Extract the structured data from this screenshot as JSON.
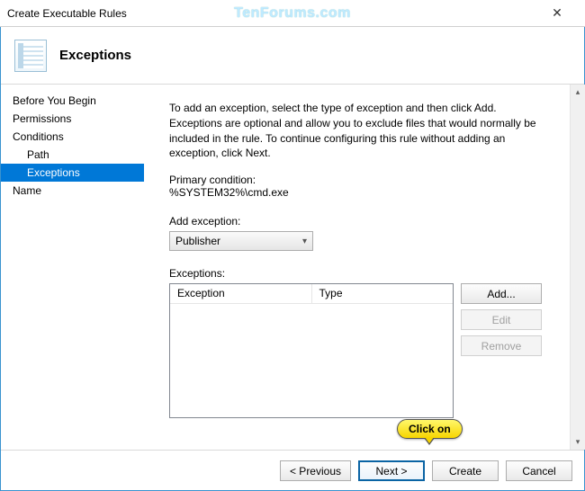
{
  "window": {
    "title": "Create Executable Rules",
    "watermark": "TenForums.com"
  },
  "header": {
    "title": "Exceptions"
  },
  "nav": {
    "items": [
      {
        "label": "Before You Begin",
        "indent": 0,
        "selected": false
      },
      {
        "label": "Permissions",
        "indent": 0,
        "selected": false
      },
      {
        "label": "Conditions",
        "indent": 0,
        "selected": false
      },
      {
        "label": "Path",
        "indent": 1,
        "selected": false
      },
      {
        "label": "Exceptions",
        "indent": 1,
        "selected": true
      },
      {
        "label": "Name",
        "indent": 0,
        "selected": false
      }
    ]
  },
  "content": {
    "description": "To add an exception, select the type of exception and then click Add. Exceptions are optional and allow you to exclude files that would normally be included in the rule. To continue configuring this rule without adding an exception, click Next.",
    "primary_label": "Primary condition:",
    "primary_value": "%SYSTEM32%\\cmd.exe",
    "add_exception_label": "Add exception:",
    "add_exception_value": "Publisher",
    "exceptions_label": "Exceptions:",
    "list_columns": {
      "col1": "Exception",
      "col2": "Type"
    },
    "buttons": {
      "add": "Add...",
      "edit": "Edit",
      "remove": "Remove"
    }
  },
  "footer": {
    "prev": "< Previous",
    "next": "Next >",
    "create": "Create",
    "cancel": "Cancel"
  },
  "callout": {
    "text": "Click on"
  }
}
